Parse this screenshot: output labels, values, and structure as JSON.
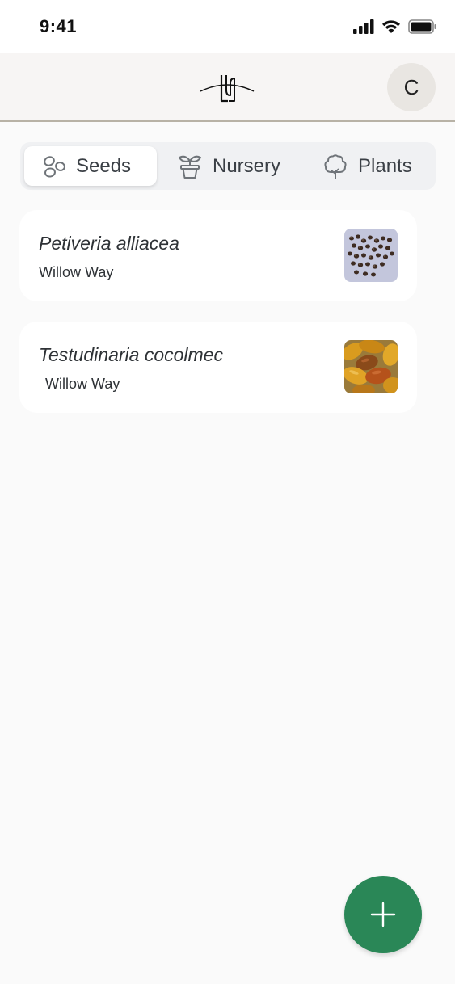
{
  "status_bar": {
    "time": "9:41",
    "icons": [
      "cellular-signal-icon",
      "wifi-icon",
      "battery-icon"
    ]
  },
  "header": {
    "logo": "app-logo-icon",
    "avatar_initial": "C"
  },
  "tabs": [
    {
      "label": "Seeds",
      "icon": "seeds-icon",
      "active": true
    },
    {
      "label": "Nursery",
      "icon": "potted-seedling-icon",
      "active": false
    },
    {
      "label": "Plants",
      "icon": "tree-icon",
      "active": false
    }
  ],
  "items": [
    {
      "name": "Petiveria alliacea",
      "location": "Willow Way",
      "thumbnail": "seed-photo-petiveria"
    },
    {
      "name": "Testudinaria cocolmec",
      "location": "Willow Way",
      "thumbnail": "seed-photo-testudinaria"
    }
  ],
  "fab": {
    "icon": "plus-icon"
  },
  "colors": {
    "accent": "#2a8757",
    "background": "#fafafa",
    "header_bg": "#f7f5f4",
    "header_divider": "#b8b2a6",
    "text": "#2e3236"
  }
}
